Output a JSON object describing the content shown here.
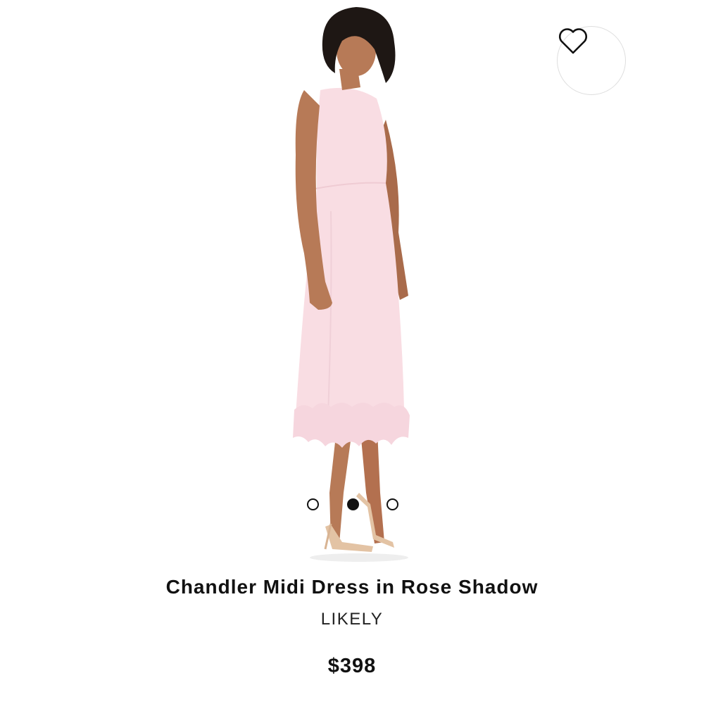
{
  "product": {
    "title": "Chandler Midi Dress in Rose Shadow",
    "brand": "LIKELY",
    "price": "$398"
  },
  "favorite": {
    "icon": "heart-outline-icon"
  },
  "carousel": {
    "count": 3,
    "active_index": 1
  },
  "colors": {
    "dress": "#f9dde3",
    "skin": "#b77a57",
    "hair": "#1e1714",
    "sandal": "#e3c3a4",
    "text": "#111111"
  }
}
